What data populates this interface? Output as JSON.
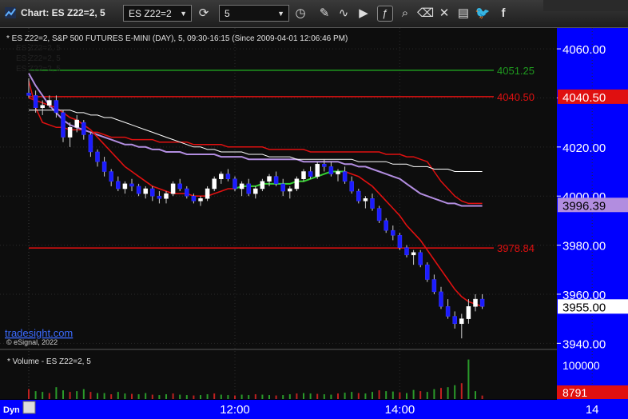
{
  "titlebar": {
    "title": "Chart: ES Z22=2, 5",
    "symbol_value": "ES Z22=2",
    "interval_value": "5",
    "icons": [
      "clock-sync-icon",
      "clock-icon",
      "draw-pen-icon",
      "indicator-wave-icon",
      "play-icon",
      "fx-study-icon",
      "zoom-icon",
      "eraser-icon",
      "comment-icon",
      "twitter-bird-icon",
      "facebook-f-icon"
    ]
  },
  "chart_data": {
    "type": "line",
    "title": "* ES Z22=2, S&P 500 FUTURES E-MINI (DAY), 5, 09:30-16:15 (Since 2009-04-01 12:06:46 PM)",
    "legend_ghost": [
      "ES Z22=2, 5",
      "ES Z22=2, 5",
      "ES Z22=2, 5"
    ],
    "y_ticks": [
      "4060.00",
      "4040.00",
      "4020.00",
      "4000.00",
      "3980.00",
      "3960.00",
      "3940.00"
    ],
    "ylim": [
      3937.5,
      4068.5
    ],
    "x_ticks": [
      "12:00",
      "14:00",
      "14"
    ],
    "x_tick_bars": [
      30,
      54,
      82
    ],
    "levels": [
      {
        "value": 4051.25,
        "label": "4051.25",
        "color": "#1f9a1f"
      },
      {
        "value": 4040.5,
        "label": "4040.50",
        "color": "#e01010"
      },
      {
        "value": 3978.84,
        "label": "3978.84",
        "color": "#e01010"
      }
    ],
    "price_tags": [
      {
        "value": 4040.5,
        "label": "4040.50",
        "bg": "#e01010",
        "fg": "#ffffff"
      },
      {
        "value": 3996.39,
        "label": "3996.39",
        "bg": "#b28de0",
        "fg": "#000000"
      },
      {
        "value": 3955.0,
        "label": "3955.00",
        "bg": "#ffffff",
        "fg": "#000000"
      }
    ],
    "candles": [
      [
        4042,
        4048,
        4040,
        4041
      ],
      [
        4041,
        4043,
        4034,
        4036
      ],
      [
        4036,
        4039,
        4033,
        4037
      ],
      [
        4037,
        4041,
        4036,
        4039
      ],
      [
        4039,
        4041,
        4032,
        4034
      ],
      [
        4034,
        4035,
        4022,
        4024
      ],
      [
        4024,
        4030,
        4020,
        4028
      ],
      [
        4028,
        4033,
        4026,
        4031
      ],
      [
        4030,
        4031,
        4023,
        4025
      ],
      [
        4025,
        4026,
        4016,
        4018
      ],
      [
        4018,
        4019,
        4012,
        4014
      ],
      [
        4014,
        4016,
        4008,
        4010
      ],
      [
        4010,
        4011,
        4004,
        4006
      ],
      [
        4006,
        4008,
        4002,
        4003
      ],
      [
        4003,
        4006,
        4001,
        4005
      ],
      [
        4005,
        4007,
        4002,
        4004
      ],
      [
        4004,
        4005,
        4000,
        4001
      ],
      [
        4001,
        4004,
        3999,
        4003
      ],
      [
        4003,
        4004,
        3998,
        4000
      ],
      [
        4000,
        4002,
        3997,
        3999
      ],
      [
        3999,
        4002,
        3997,
        4001
      ],
      [
        4001,
        4006,
        4000,
        4005
      ],
      [
        4005,
        4007,
        4002,
        4003
      ],
      [
        4003,
        4004,
        3999,
        4000
      ],
      [
        4000,
        4001,
        3997,
        3998
      ],
      [
        3998,
        4000,
        3996,
        3999
      ],
      [
        3999,
        4004,
        3998,
        4003
      ],
      [
        4003,
        4008,
        4002,
        4007
      ],
      [
        4007,
        4010,
        4005,
        4009
      ],
      [
        4009,
        4011,
        4006,
        4007
      ],
      [
        4007,
        4008,
        4002,
        4003
      ],
      [
        4003,
        4006,
        4000,
        4005
      ],
      [
        4005,
        4007,
        4000,
        4001
      ],
      [
        4001,
        4004,
        3999,
        4003
      ],
      [
        4003,
        4007,
        4002,
        4006
      ],
      [
        4006,
        4009,
        4004,
        4008
      ],
      [
        4008,
        4010,
        4004,
        4005
      ],
      [
        4005,
        4007,
        4000,
        4002
      ],
      [
        4002,
        4004,
        3999,
        4003
      ],
      [
        4003,
        4008,
        4002,
        4007
      ],
      [
        4007,
        4011,
        4006,
        4010
      ],
      [
        4010,
        4012,
        4007,
        4008
      ],
      [
        4008,
        4014,
        4007,
        4013
      ],
      [
        4013,
        4015,
        4010,
        4012
      ],
      [
        4012,
        4014,
        4008,
        4009
      ],
      [
        4009,
        4011,
        4006,
        4010
      ],
      [
        4010,
        4012,
        4005,
        4006
      ],
      [
        4006,
        4008,
        4001,
        4002
      ],
      [
        4002,
        4003,
        3997,
        3998
      ],
      [
        3998,
        4000,
        3995,
        3999
      ],
      [
        3999,
        4001,
        3994,
        3995
      ],
      [
        3995,
        3996,
        3989,
        3990
      ],
      [
        3990,
        3991,
        3985,
        3986
      ],
      [
        3986,
        3988,
        3982,
        3984
      ],
      [
        3984,
        3985,
        3978,
        3979
      ],
      [
        3979,
        3980,
        3975,
        3976
      ],
      [
        3976,
        3978,
        3972,
        3977
      ],
      [
        3977,
        3978,
        3971,
        3972
      ],
      [
        3972,
        3973,
        3965,
        3966
      ],
      [
        3966,
        3968,
        3960,
        3961
      ],
      [
        3961,
        3963,
        3954,
        3955
      ],
      [
        3955,
        3958,
        3950,
        3951
      ],
      [
        3951,
        3953,
        3946,
        3948
      ],
      [
        3948,
        3952,
        3942,
        3950
      ],
      [
        3950,
        3958,
        3948,
        3955
      ],
      [
        3955,
        3960,
        3953,
        3958
      ],
      [
        3958,
        3960,
        3954,
        3955
      ]
    ],
    "moving_averages": [
      {
        "color": "#e01010",
        "values": [
          4040,
          4039,
          4038,
          4037,
          4036,
          4034,
          4032,
          4031,
          4029,
          4027,
          4024,
          4021,
          4018,
          4015,
          4012,
          4010,
          4008,
          4006,
          4004,
          4003,
          4002,
          4001,
          4001,
          4001,
          4000,
          4000,
          4000,
          4001,
          4002,
          4003,
          4003,
          4004,
          4004,
          4004,
          4005,
          4005,
          4005,
          4005,
          4005,
          4006,
          4006,
          4007,
          4008,
          4009,
          4010,
          4010,
          4010,
          4009,
          4008,
          4006,
          4004,
          4001,
          3998,
          3995,
          3992,
          3988,
          3985,
          3982,
          3978,
          3974,
          3970,
          3966,
          3962,
          3959,
          3957,
          3956,
          3955
        ]
      },
      {
        "color": "#ffffff",
        "values": [
          4035,
          4035,
          4035,
          4035,
          4035,
          4035,
          4035,
          4034,
          4034,
          4033,
          4033,
          4032,
          4032,
          4031,
          4030,
          4029,
          4028,
          4027,
          4026,
          4025,
          4024,
          4023,
          4022,
          4021,
          4020,
          4020,
          4019,
          4019,
          4018,
          4018,
          4018,
          4018,
          4017,
          4017,
          4017,
          4016,
          4016,
          4016,
          4016,
          4015,
          4015,
          4015,
          4015,
          4015,
          4015,
          4015,
          4015,
          4015,
          4014,
          4014,
          4014,
          4014,
          4014,
          4013,
          4013,
          4013,
          4012,
          4012,
          4012,
          4011,
          4011,
          4011,
          4010,
          4010,
          4010,
          4010,
          4010
        ]
      }
    ],
    "bands": [
      {
        "color": "#e01010",
        "values": [
          4047,
          4036,
          4030,
          4029,
          4028,
          4028,
          4027,
          4027,
          4027,
          4026,
          4026,
          4025,
          4024,
          4024,
          4024,
          4023,
          4023,
          4023,
          4023,
          4022,
          4022,
          4022,
          4022,
          4022,
          4021,
          4021,
          4021,
          4021,
          4021,
          4020,
          4020,
          4020,
          4020,
          4020,
          4020,
          4019,
          4019,
          4019,
          4019,
          4019,
          4019,
          4018,
          4018,
          4018,
          4018,
          4018,
          4018,
          4018,
          4018,
          4018,
          4018,
          4018,
          4017,
          4017,
          4017,
          4016,
          4016,
          4015,
          4014,
          4010,
          4006,
          4003,
          4000,
          3998,
          3997,
          3997,
          3997
        ]
      }
    ],
    "vwap": {
      "color": "#b28de0",
      "values": [
        4050,
        4045,
        4041,
        4037,
        4034,
        4031,
        4029,
        4028,
        4027,
        4026,
        4025,
        4024,
        4023,
        4022,
        4021,
        4021,
        4020,
        4020,
        4019,
        4019,
        4018,
        4018,
        4018,
        4017,
        4017,
        4017,
        4017,
        4017,
        4016,
        4016,
        4016,
        4016,
        4015,
        4015,
        4015,
        4015,
        4015,
        4015,
        4015,
        4015,
        4014,
        4014,
        4014,
        4014,
        4014,
        4014,
        4013,
        4013,
        4012,
        4012,
        4011,
        4010,
        4009,
        4008,
        4007,
        4005,
        4003,
        4001,
        4000,
        3999,
        3998,
        3997,
        3997,
        3996,
        3996,
        3996,
        3996
      ]
    },
    "green_segment": {
      "color": "#32d232",
      "start": 30,
      "end": 46
    },
    "volume": {
      "label": "* Volume - ES Z22=2, 5",
      "y_ticks": [
        "100000"
      ],
      "last_label": "8791",
      "values": [
        25,
        20,
        18,
        15,
        30,
        22,
        18,
        20,
        25,
        18,
        15,
        15,
        12,
        18,
        14,
        13,
        12,
        15,
        11,
        10,
        12,
        14,
        11,
        10,
        9,
        10,
        12,
        14,
        11,
        10,
        9,
        11,
        10,
        12,
        11,
        10,
        9,
        10,
        12,
        14,
        15,
        14,
        13,
        12,
        11,
        14,
        16,
        18,
        15,
        14,
        18,
        22,
        20,
        19,
        17,
        15,
        23,
        20,
        18,
        25,
        28,
        30,
        35,
        40,
        100,
        20,
        8.8
      ]
    },
    "watermark": [
      "tradesight.com",
      "© eSignal, 2022"
    ],
    "bottom_bar": {
      "dyn_label": "Dyn"
    }
  }
}
